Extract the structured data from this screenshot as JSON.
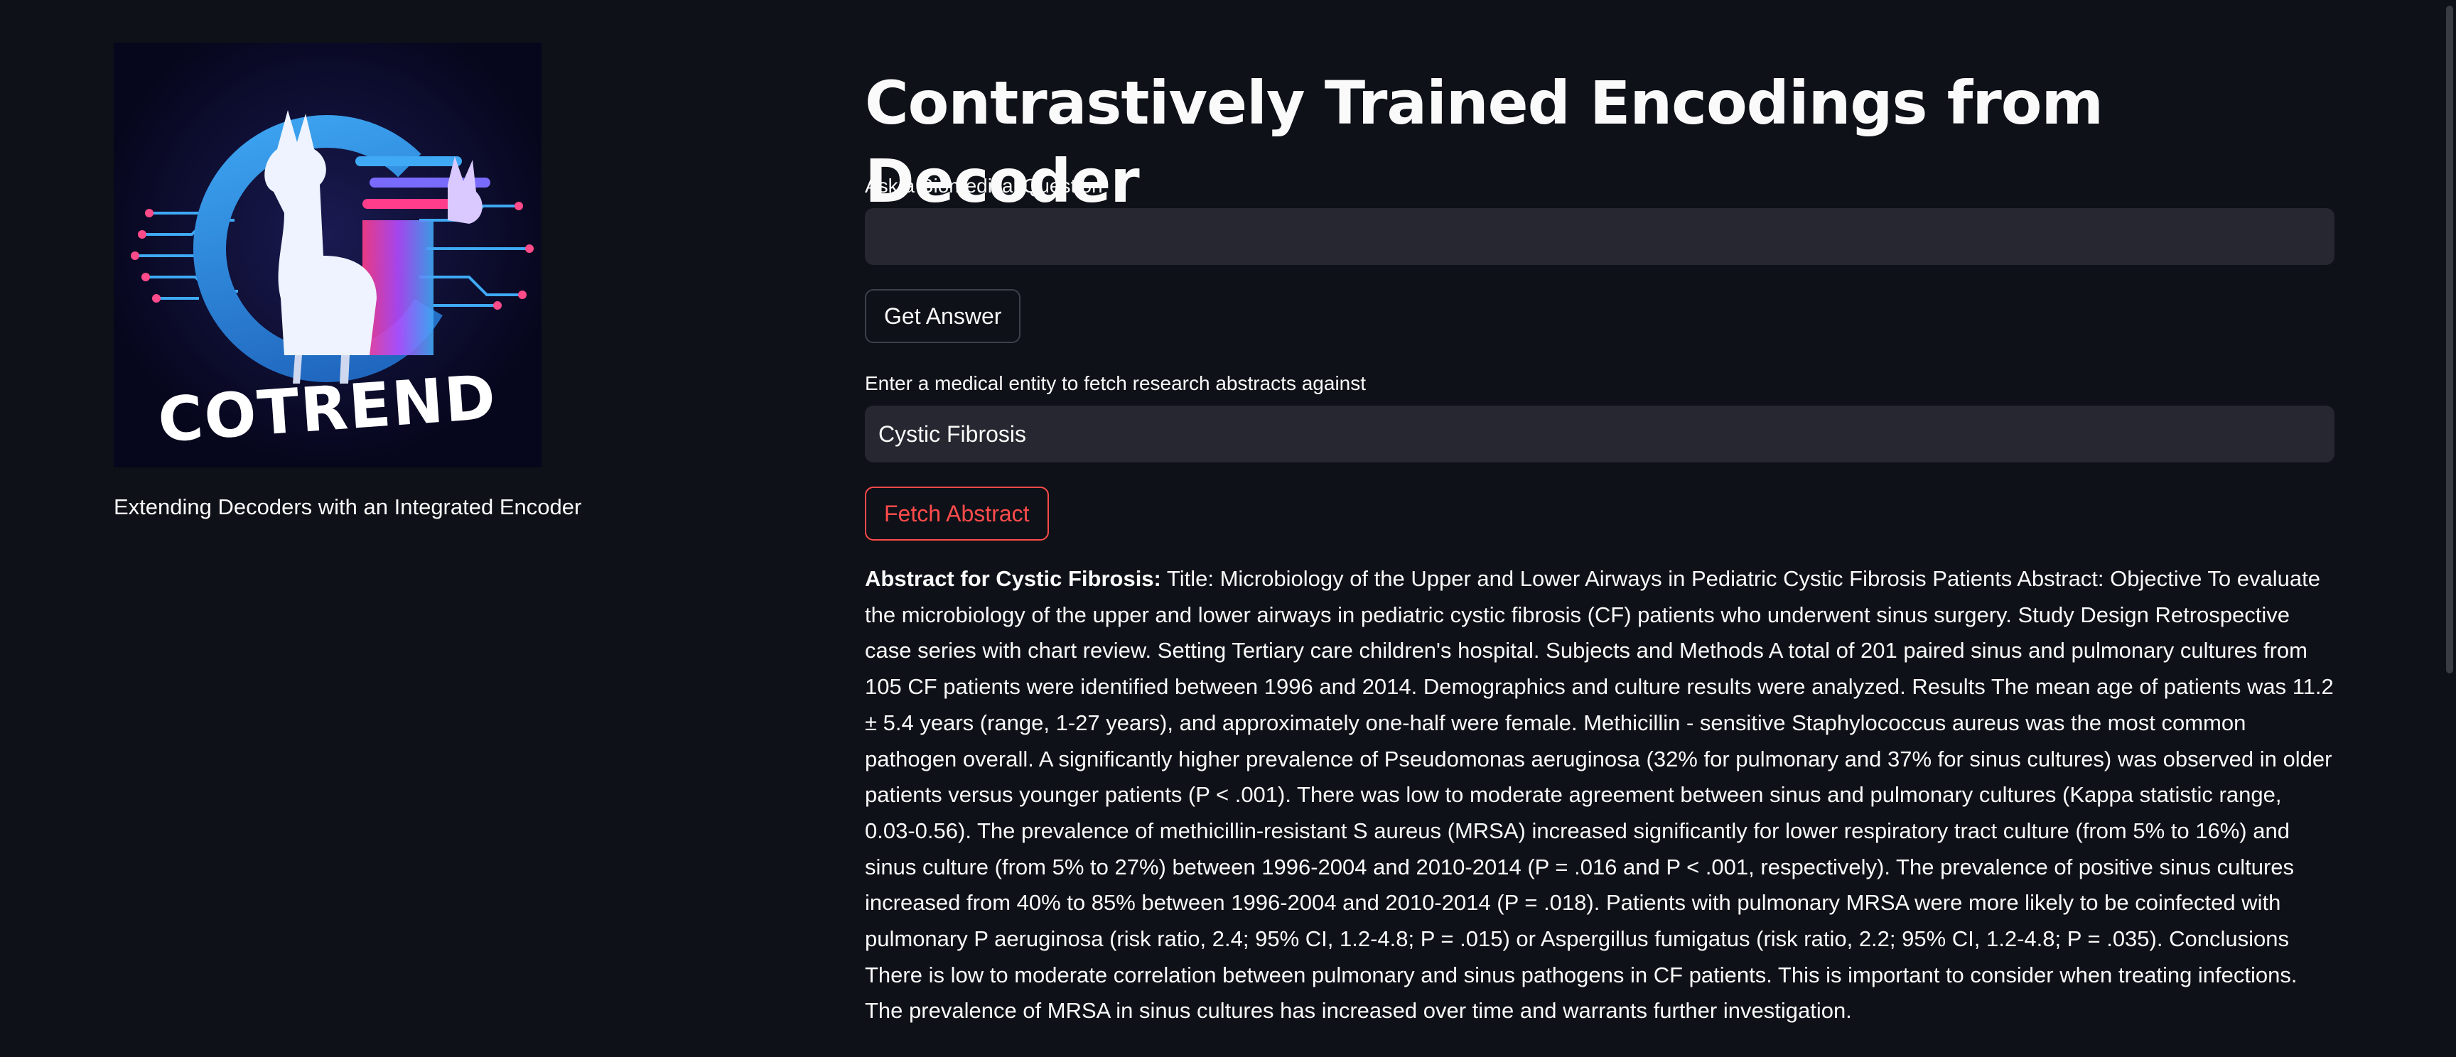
{
  "sidebar": {
    "logo_text": "COTREND",
    "caption": "Extending Decoders with an Integrated Encoder"
  },
  "main": {
    "title": "Contrastively Trained Encodings from Decoder",
    "question_label": "Ask a Biomedical Question",
    "question_value": "",
    "get_answer_label": "Get Answer",
    "entity_label": "Enter a medical entity to fetch research abstracts against",
    "entity_value": "Cystic Fibrosis",
    "fetch_label": "Fetch Abstract",
    "abstract_heading": "Abstract for Cystic Fibrosis:",
    "abstract_text": " Title: Microbiology of the Upper and Lower Airways in Pediatric Cystic Fibrosis Patients Abstract: Objective To evaluate the microbiology of the upper and lower airways in pediatric cystic fibrosis (CF) patients who underwent sinus surgery. Study Design Retrospective case series with chart review. Setting Tertiary care children's hospital. Subjects and Methods A total of 201 paired sinus and pulmonary cultures from 105 CF patients were identified between 1996 and 2014. Demographics and culture results were analyzed. Results The mean age of patients was 11.2 ± 5.4 years (range, 1-27 years), and approximately one-half were female. Methicillin - sensitive Staphylococcus aureus was the most common pathogen overall. A significantly higher prevalence of Pseudomonas aeruginosa (32% for pulmonary and 37% for sinus cultures) was observed in older patients versus younger patients (P < .001). There was low to moderate agreement between sinus and pulmonary cultures (Kappa statistic range, 0.03-0.56). The prevalence of methicillin-resistant S aureus (MRSA) increased significantly for lower respiratory tract culture (from 5% to 16%) and sinus culture (from 5% to 27%) between 1996-2004 and 2010-2014 (P = .016 and P < .001, respectively). The prevalence of positive sinus cultures increased from 40% to 85% between 1996-2004 and 2010-2014 (P = .018). Patients with pulmonary MRSA were more likely to be coinfected with pulmonary P aeruginosa (risk ratio, 2.4; 95% CI, 1.2-4.8; P = .015) or Aspergillus fumigatus (risk ratio, 2.2; 95% CI, 1.2-4.8; P = .035). Conclusions There is low to moderate correlation between pulmonary and sinus pathogens in CF patients. This is important to consider when treating infections. The prevalence of MRSA in sinus cultures has increased over time and warrants further investigation."
  },
  "colors": {
    "background": "#0e1117",
    "input_bg": "#262730",
    "accent": "#ff4b4b",
    "text": "#fafafa"
  }
}
